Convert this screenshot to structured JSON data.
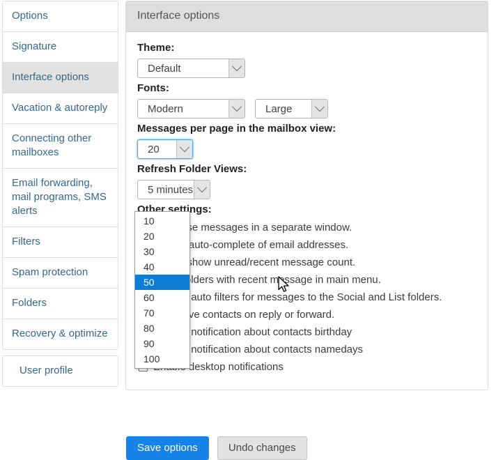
{
  "sidebar": {
    "groups": [
      {
        "name": "settings-nav",
        "items": [
          {
            "label": "Options",
            "active": false
          },
          {
            "label": "Signature",
            "active": false
          },
          {
            "label": "Interface options",
            "active": true
          },
          {
            "label": "Vacation & autoreply",
            "active": false
          },
          {
            "label": "Connecting other mailboxes",
            "active": false
          },
          {
            "label": "Email forwarding, mail programs, SMS alerts",
            "active": false
          },
          {
            "label": "Filters",
            "active": false
          },
          {
            "label": "Spam protection",
            "active": false
          },
          {
            "label": "Folders",
            "active": false
          },
          {
            "label": "Recovery & optimize",
            "active": false
          }
        ]
      },
      {
        "name": "profile-nav",
        "items": [
          {
            "label": "User profile",
            "active": false
          }
        ]
      }
    ]
  },
  "panel": {
    "header_title": "Interface options",
    "theme": {
      "label": "Theme:",
      "value": "Default"
    },
    "fonts": {
      "label": "Fonts:",
      "family_value": "Modern",
      "size_value": "Large"
    },
    "messages_per_page": {
      "label": "Messages per page in the mailbox view:",
      "value": "20",
      "open": true,
      "highlighted_option": "50",
      "options": [
        "10",
        "20",
        "30",
        "40",
        "50",
        "60",
        "70",
        "80",
        "90",
        "100"
      ]
    },
    "refresh_folder_views": {
      "label": "Refresh Folder Views:",
      "value": "5 minutes"
    },
    "other_settings": {
      "label": "Other settings:",
      "checkboxes": [
        {
          "label": "Compose messages in a separate window.",
          "checked": false
        },
        {
          "label": "Enable auto-complete of email addresses.",
          "checked": false
        },
        {
          "label": "Do not show unread/recent message count.",
          "checked": false
        },
        {
          "label": "Show folders with recent message in main menu.",
          "checked": false
        },
        {
          "label": "Disable auto filters for messages to the Social and List folders.",
          "checked": false
        },
        {
          "label": "Auto save contacts on reply or forward.",
          "checked": false
        },
        {
          "label": "Disable notification about contacts birthday",
          "checked": false
        },
        {
          "label": "Disable notification about contacts namedays",
          "checked": false
        },
        {
          "label": "Enable desktop notifications",
          "checked": false
        }
      ]
    }
  },
  "footer": {
    "save_label": "Save options",
    "undo_label": "Undo changes"
  },
  "colors": {
    "link": "#36688d",
    "active_nav_bg": "#e2e2e2",
    "panel_header_bg": "#dedede",
    "dropdown_highlight": "#0c7cd5",
    "primary_button": "#1783e8",
    "secondary_button": "#e2e2e2",
    "focus_outline": "#4aa3e8"
  }
}
